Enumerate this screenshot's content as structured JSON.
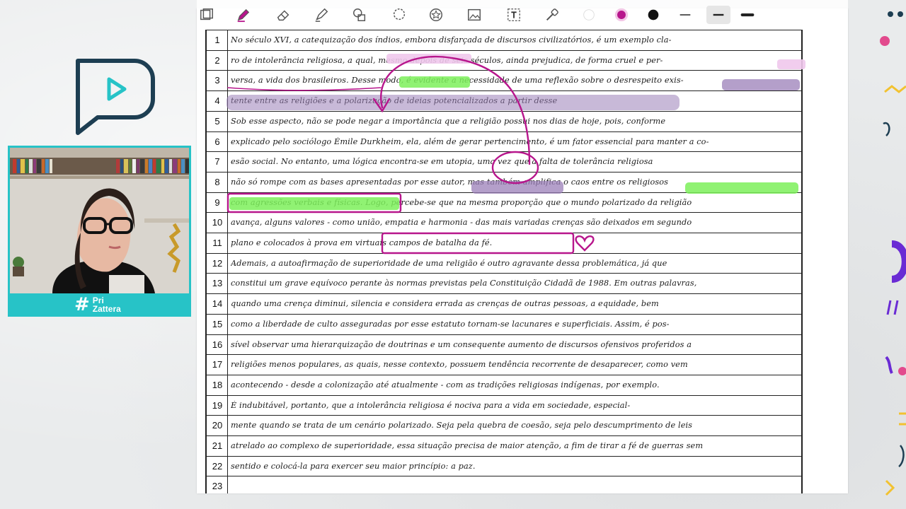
{
  "brand": {
    "hash": "#",
    "line1": "Pri",
    "line2": "Zattera"
  },
  "toolbar": {
    "icons": [
      "layers-icon",
      "pen-icon",
      "eraser-icon",
      "highlighter-icon",
      "shapes-icon",
      "lasso-icon",
      "sticker-icon",
      "image-icon",
      "text-icon",
      "laser-icon"
    ],
    "pen_color_1": "#b7168c",
    "pen_color_2": "#111111"
  },
  "colors": {
    "accent": "#27c3c7",
    "ink": "#1b1b1b",
    "annotation": "#b7168c",
    "highlight_green": "#7cf05a",
    "highlight_purple": "#9b7fb8",
    "highlight_pink": "#f0c8ec"
  },
  "document": {
    "lines": [
      {
        "n": "1",
        "text": "No século XVI, a catequização dos índios, embora disfarçada de discursos civilizatórios, é um exemplo cla-"
      },
      {
        "n": "2",
        "text": "ro de intolerância religiosa, a qual, mesmo depois de seis séculos, ainda prejudica, de forma cruel e per-"
      },
      {
        "n": "3",
        "text": "versa, a vida dos brasileiros. Desse modo, é evidente a necessidade de uma reflexão sobre o desrespeito exis-"
      },
      {
        "n": "4",
        "text": "tente entre as religiões e a polarização de ideias potencializados a partir desse"
      },
      {
        "n": "5",
        "text": "Sob esse aspecto, não se pode negar a importância que a religião possui nos dias de hoje, pois, conforme"
      },
      {
        "n": "6",
        "text": "explicado pelo sociólogo Émile Durkheim, ela, além de gerar pertencimento, é um fator essencial para manter a co-"
      },
      {
        "n": "7",
        "text": "esão social. No entanto, uma lógica encontra-se em utopia, uma vez que a falta de tolerância religiosa"
      },
      {
        "n": "8",
        "text": "não só rompe com as bases apresentadas por esse autor, mas também amplifica o caos entre os religiosos"
      },
      {
        "n": "9",
        "text": "com agressões verbais e físicas. Logo, percebe-se que na mesma proporção que o mundo polarizado da religião"
      },
      {
        "n": "10",
        "text": "avança, alguns valores - como união, empatia e harmonia - das mais variadas crenças são deixados em segundo"
      },
      {
        "n": "11",
        "text": "plano e colocados à prova em virtuais campos de batalha da fé."
      },
      {
        "n": "12",
        "text": "Ademais, a autoafirmação de superioridade de uma religião é outro agravante dessa problemática, já que"
      },
      {
        "n": "13",
        "text": "constitui um grave equívoco perante às normas previstas pela Constituição Cidadã de 1988. Em outras palavras,"
      },
      {
        "n": "14",
        "text": "quando uma crença diminui, silencia e considera errada as crenças de outras pessoas, a equidade, bem"
      },
      {
        "n": "15",
        "text": "como a liberdade de culto asseguradas por esse estatuto tornam-se lacunares e superficiais. Assim, é pos-"
      },
      {
        "n": "16",
        "text": "sível observar uma hierarquização de doutrinas e um consequente aumento de discursos ofensivos proferidos a"
      },
      {
        "n": "17",
        "text": "religiões menos populares, as quais, nesse contexto, possuem tendência recorrente de desaparecer, como vem"
      },
      {
        "n": "18",
        "text": "acontecendo - desde a colonização até atualmente - com as tradições religiosas indígenas, por exemplo."
      },
      {
        "n": "19",
        "text": "É indubitável, portanto, que a intolerância religiosa é nociva para a vida em sociedade, especial-"
      },
      {
        "n": "20",
        "text": "mente quando se trata de um cenário polarizado. Seja pela quebra de coesão, seja pelo descumprimento de leis"
      },
      {
        "n": "21",
        "text": "atrelado ao complexo de superioridade, essa situação precisa de maior atenção, a fim de tirar a fé de guerras sem"
      },
      {
        "n": "22",
        "text": "sentido e colocá-la para exercer seu maior princípio: a paz."
      },
      {
        "n": "23",
        "text": ""
      }
    ]
  }
}
